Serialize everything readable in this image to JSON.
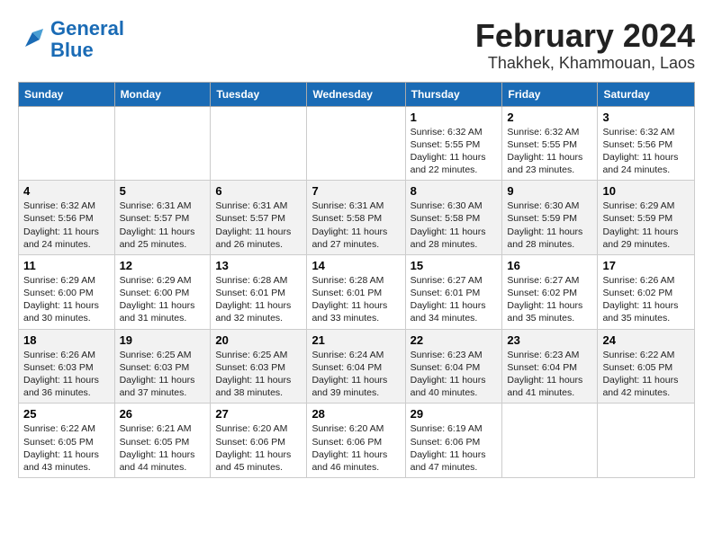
{
  "logo": {
    "line1": "General",
    "line2": "Blue"
  },
  "title": "February 2024",
  "subtitle": "Thakhek, Khammouan, Laos",
  "days_of_week": [
    "Sunday",
    "Monday",
    "Tuesday",
    "Wednesday",
    "Thursday",
    "Friday",
    "Saturday"
  ],
  "weeks": [
    [
      {
        "day": "",
        "info": ""
      },
      {
        "day": "",
        "info": ""
      },
      {
        "day": "",
        "info": ""
      },
      {
        "day": "",
        "info": ""
      },
      {
        "day": "1",
        "info": "Sunrise: 6:32 AM\nSunset: 5:55 PM\nDaylight: 11 hours and 22 minutes."
      },
      {
        "day": "2",
        "info": "Sunrise: 6:32 AM\nSunset: 5:55 PM\nDaylight: 11 hours and 23 minutes."
      },
      {
        "day": "3",
        "info": "Sunrise: 6:32 AM\nSunset: 5:56 PM\nDaylight: 11 hours and 24 minutes."
      }
    ],
    [
      {
        "day": "4",
        "info": "Sunrise: 6:32 AM\nSunset: 5:56 PM\nDaylight: 11 hours and 24 minutes."
      },
      {
        "day": "5",
        "info": "Sunrise: 6:31 AM\nSunset: 5:57 PM\nDaylight: 11 hours and 25 minutes."
      },
      {
        "day": "6",
        "info": "Sunrise: 6:31 AM\nSunset: 5:57 PM\nDaylight: 11 hours and 26 minutes."
      },
      {
        "day": "7",
        "info": "Sunrise: 6:31 AM\nSunset: 5:58 PM\nDaylight: 11 hours and 27 minutes."
      },
      {
        "day": "8",
        "info": "Sunrise: 6:30 AM\nSunset: 5:58 PM\nDaylight: 11 hours and 28 minutes."
      },
      {
        "day": "9",
        "info": "Sunrise: 6:30 AM\nSunset: 5:59 PM\nDaylight: 11 hours and 28 minutes."
      },
      {
        "day": "10",
        "info": "Sunrise: 6:29 AM\nSunset: 5:59 PM\nDaylight: 11 hours and 29 minutes."
      }
    ],
    [
      {
        "day": "11",
        "info": "Sunrise: 6:29 AM\nSunset: 6:00 PM\nDaylight: 11 hours and 30 minutes."
      },
      {
        "day": "12",
        "info": "Sunrise: 6:29 AM\nSunset: 6:00 PM\nDaylight: 11 hours and 31 minutes."
      },
      {
        "day": "13",
        "info": "Sunrise: 6:28 AM\nSunset: 6:01 PM\nDaylight: 11 hours and 32 minutes."
      },
      {
        "day": "14",
        "info": "Sunrise: 6:28 AM\nSunset: 6:01 PM\nDaylight: 11 hours and 33 minutes."
      },
      {
        "day": "15",
        "info": "Sunrise: 6:27 AM\nSunset: 6:01 PM\nDaylight: 11 hours and 34 minutes."
      },
      {
        "day": "16",
        "info": "Sunrise: 6:27 AM\nSunset: 6:02 PM\nDaylight: 11 hours and 35 minutes."
      },
      {
        "day": "17",
        "info": "Sunrise: 6:26 AM\nSunset: 6:02 PM\nDaylight: 11 hours and 35 minutes."
      }
    ],
    [
      {
        "day": "18",
        "info": "Sunrise: 6:26 AM\nSunset: 6:03 PM\nDaylight: 11 hours and 36 minutes."
      },
      {
        "day": "19",
        "info": "Sunrise: 6:25 AM\nSunset: 6:03 PM\nDaylight: 11 hours and 37 minutes."
      },
      {
        "day": "20",
        "info": "Sunrise: 6:25 AM\nSunset: 6:03 PM\nDaylight: 11 hours and 38 minutes."
      },
      {
        "day": "21",
        "info": "Sunrise: 6:24 AM\nSunset: 6:04 PM\nDaylight: 11 hours and 39 minutes."
      },
      {
        "day": "22",
        "info": "Sunrise: 6:23 AM\nSunset: 6:04 PM\nDaylight: 11 hours and 40 minutes."
      },
      {
        "day": "23",
        "info": "Sunrise: 6:23 AM\nSunset: 6:04 PM\nDaylight: 11 hours and 41 minutes."
      },
      {
        "day": "24",
        "info": "Sunrise: 6:22 AM\nSunset: 6:05 PM\nDaylight: 11 hours and 42 minutes."
      }
    ],
    [
      {
        "day": "25",
        "info": "Sunrise: 6:22 AM\nSunset: 6:05 PM\nDaylight: 11 hours and 43 minutes."
      },
      {
        "day": "26",
        "info": "Sunrise: 6:21 AM\nSunset: 6:05 PM\nDaylight: 11 hours and 44 minutes."
      },
      {
        "day": "27",
        "info": "Sunrise: 6:20 AM\nSunset: 6:06 PM\nDaylight: 11 hours and 45 minutes."
      },
      {
        "day": "28",
        "info": "Sunrise: 6:20 AM\nSunset: 6:06 PM\nDaylight: 11 hours and 46 minutes."
      },
      {
        "day": "29",
        "info": "Sunrise: 6:19 AM\nSunset: 6:06 PM\nDaylight: 11 hours and 47 minutes."
      },
      {
        "day": "",
        "info": ""
      },
      {
        "day": "",
        "info": ""
      }
    ]
  ]
}
